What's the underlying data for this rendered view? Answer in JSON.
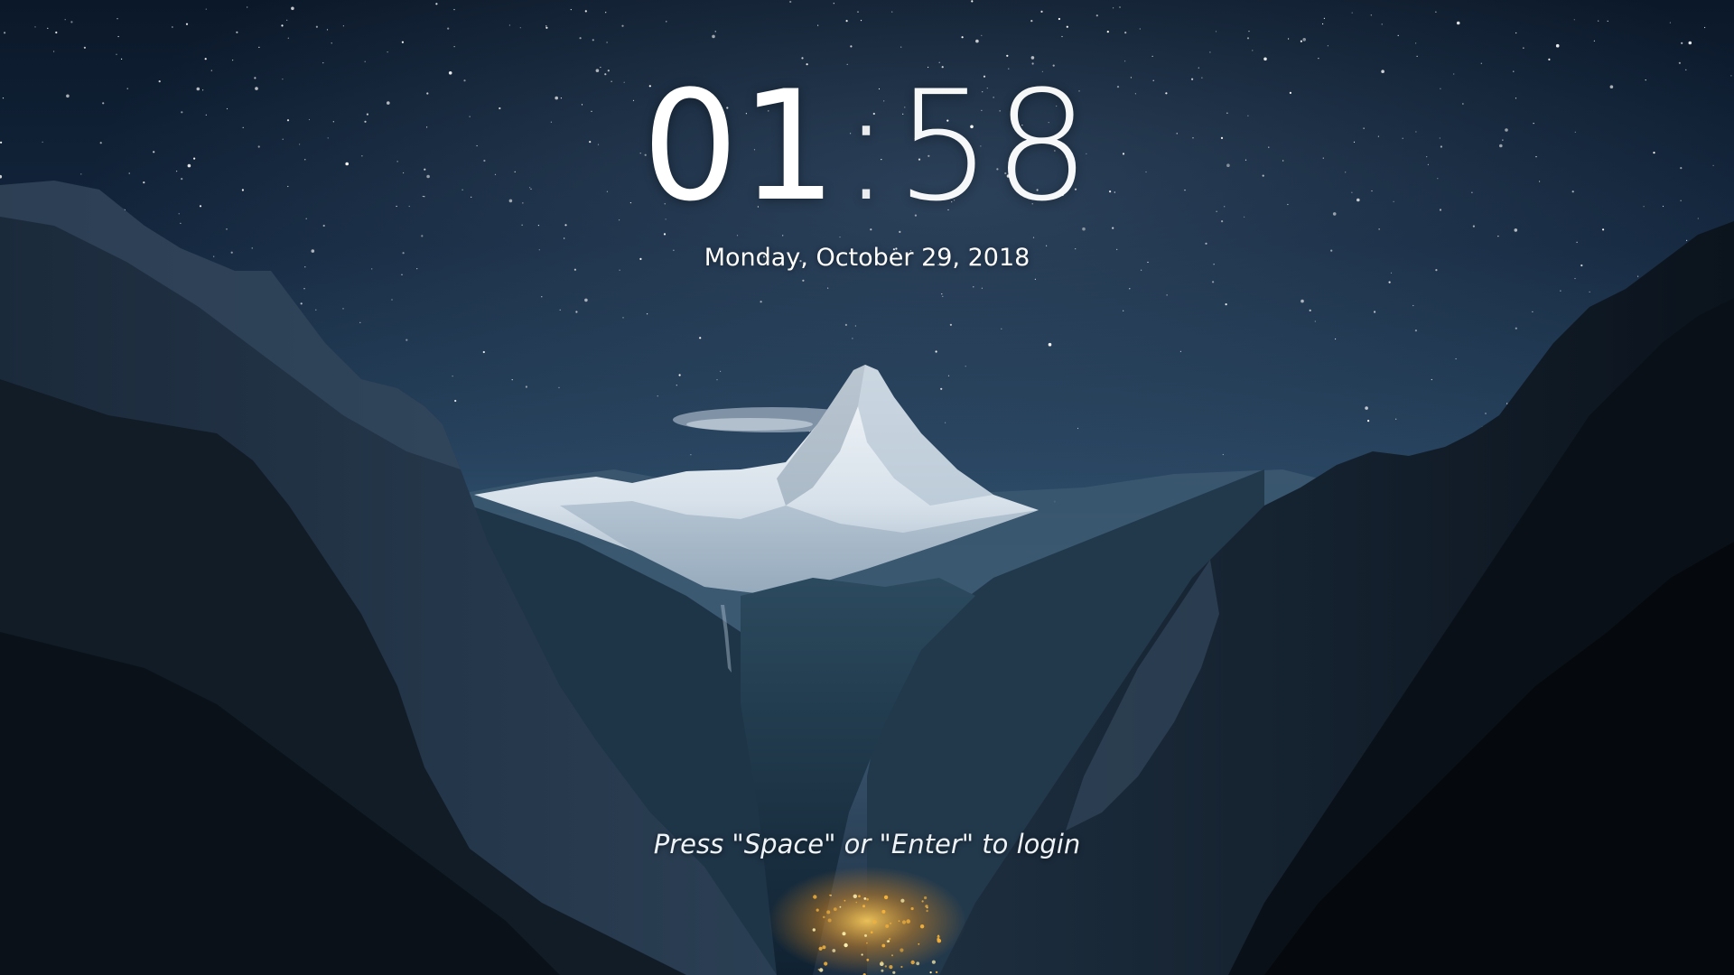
{
  "lockscreen": {
    "clock": {
      "hours": "01",
      "separator": ":",
      "minutes": "58"
    },
    "date": "Monday, October 29, 2018",
    "login_prompt": "Press \"Space\" or \"Enter\" to login"
  },
  "wallpaper": {
    "sky_top": "#0c1a2e",
    "sky_horizon": "#3d5d7a",
    "snow": "#e8eef3",
    "mountain_dark": "#0b1119",
    "valley_lights": "#f5b23a"
  }
}
